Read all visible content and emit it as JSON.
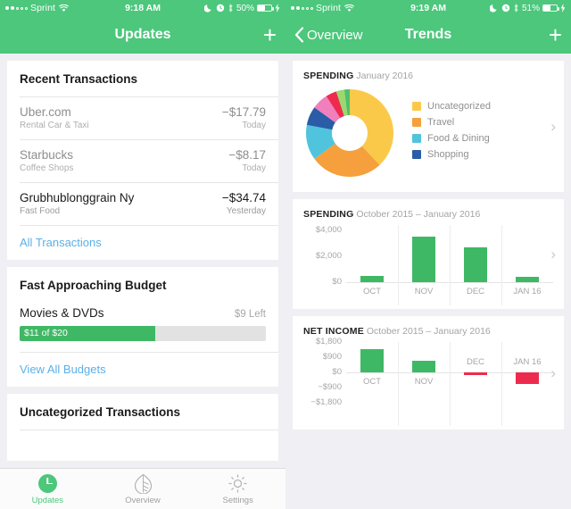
{
  "left": {
    "status": {
      "carrier": "Sprint",
      "time": "9:18 AM",
      "battery_pct": "50%"
    },
    "nav": {
      "title": "Updates",
      "add_label": "+"
    },
    "recent": {
      "header": "Recent Transactions",
      "rows": [
        {
          "name": "Uber.com",
          "category": "Rental Car & Taxi",
          "amount": "−$17.79",
          "when": "Today",
          "dark": false
        },
        {
          "name": "Starbucks",
          "category": "Coffee Shops",
          "amount": "−$8.17",
          "when": "Today",
          "dark": false
        },
        {
          "name": "Grubhublonggrain Ny",
          "category": "Fast Food",
          "amount": "−$34.74",
          "when": "Yesterday",
          "dark": true
        }
      ],
      "link": "All Transactions"
    },
    "budget": {
      "header": "Fast Approaching Budget",
      "name": "Movies & DVDs",
      "left_label": "$9 Left",
      "bar_label": "$11 of $20",
      "spent": 11,
      "total": 20,
      "link": "View All Budgets"
    },
    "uncategorized": {
      "header": "Uncategorized Transactions"
    },
    "tabs": [
      {
        "label": "Updates",
        "icon": "clock-icon",
        "active": true
      },
      {
        "label": "Overview",
        "icon": "leaf-icon",
        "active": false
      },
      {
        "label": "Settings",
        "icon": "gear-icon",
        "active": false
      }
    ]
  },
  "right": {
    "status": {
      "carrier": "Sprint",
      "time": "9:19 AM",
      "battery_pct": "51%"
    },
    "nav": {
      "back": "Overview",
      "title": "Trends",
      "add_label": "+"
    },
    "spending_pie": {
      "title": "SPENDING",
      "period": "January 2016"
    },
    "spending_bar": {
      "title": "SPENDING",
      "period": "October 2015 – January 2016"
    },
    "net_income": {
      "title": "NET INCOME",
      "period": "October 2015 – January 2016"
    }
  },
  "colors": {
    "green": "#4CC77C",
    "bar_green": "#3FB865",
    "red": "#ED2B4F",
    "link_blue": "#5BB0E8",
    "uncategorized": "#FBC94A",
    "travel": "#F5A03C",
    "food_dining": "#4FC4DC",
    "shopping": "#2A5CA8"
  },
  "chart_data": [
    {
      "type": "pie",
      "title": "SPENDING",
      "subtitle": "January 2016",
      "legend_position": "right",
      "labels": [
        "Uncategorized",
        "Travel",
        "Food & Dining",
        "Shopping",
        "Pink",
        "Red",
        "Light Green",
        "Green"
      ],
      "values": [
        38,
        27,
        13,
        7,
        6,
        4,
        3,
        2
      ],
      "colors": [
        "#FBC94A",
        "#F5A03C",
        "#4FC4DC",
        "#2A5CA8",
        "#F07FBC",
        "#ED2B4F",
        "#9BD86E",
        "#4FBF6E"
      ],
      "legend_entries": [
        "Uncategorized",
        "Travel",
        "Food & Dining",
        "Shopping"
      ]
    },
    {
      "type": "bar",
      "title": "SPENDING",
      "subtitle": "October 2015 – January 2016",
      "categories": [
        "OCT",
        "NOV",
        "DEC",
        "JAN 16"
      ],
      "values": [
        500,
        3500,
        2700,
        400
      ],
      "ytick_labels": [
        "$4,000",
        "$2,000",
        "$0"
      ],
      "ytick_values": [
        4000,
        2000,
        0
      ],
      "ylim": [
        0,
        4400
      ],
      "bar_color": "#3FB865",
      "grid": "vertical"
    },
    {
      "type": "bar",
      "title": "NET INCOME",
      "subtitle": "October 2015 – January 2016",
      "categories": [
        "OCT",
        "NOV",
        "DEC",
        "JAN 16"
      ],
      "values": [
        1400,
        700,
        -150,
        -700
      ],
      "ytick_labels": [
        "$1,800",
        "$900",
        "$0",
        "−$900",
        "−$1,800"
      ],
      "ytick_values": [
        1800,
        900,
        0,
        -900,
        -1800
      ],
      "ylim": [
        -1800,
        1800
      ],
      "positive_color": "#3FB865",
      "negative_color": "#ED2B4F",
      "grid": "vertical"
    }
  ]
}
